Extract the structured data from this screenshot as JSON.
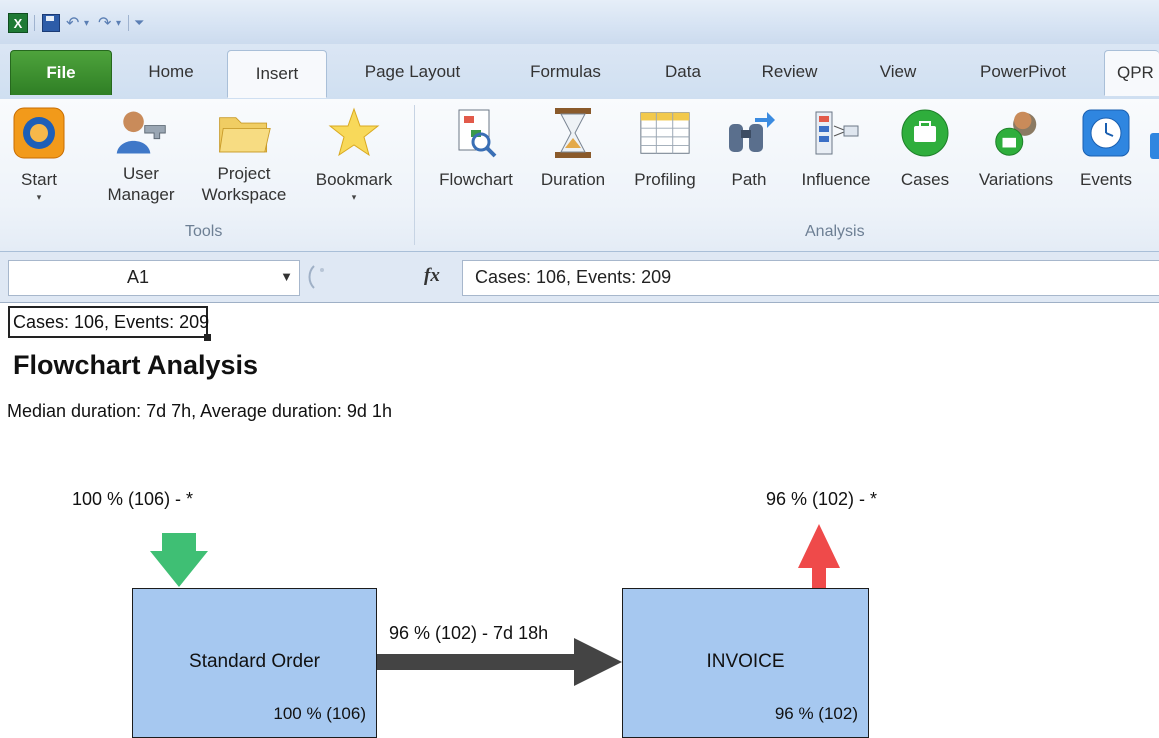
{
  "titlebar": {
    "icons": [
      "excel-logo-icon",
      "save-icon",
      "undo-icon",
      "redo-icon",
      "customize-quick-access-icon"
    ],
    "logo_letter": "X"
  },
  "tabs": [
    {
      "label": "File"
    },
    {
      "label": "Home"
    },
    {
      "label": "Insert"
    },
    {
      "label": "Page Layout"
    },
    {
      "label": "Formulas"
    },
    {
      "label": "Data"
    },
    {
      "label": "Review"
    },
    {
      "label": "View"
    },
    {
      "label": "PowerPivot"
    },
    {
      "label": "QPR"
    }
  ],
  "ribbon": {
    "groups": [
      {
        "label": "Tools"
      },
      {
        "label": "Analysis"
      }
    ],
    "tools": [
      {
        "label": "Start",
        "icon": "start-icon",
        "dropdown": "▾"
      },
      {
        "label": "User\nManager",
        "icon": "user-manager-icon"
      },
      {
        "label": "Project\nWorkspace",
        "icon": "folder-icon"
      },
      {
        "label": "Bookmark",
        "icon": "star-icon",
        "dropdown": "▾"
      }
    ],
    "analysis": [
      {
        "label": "Flowchart",
        "icon": "flowchart-icon"
      },
      {
        "label": "Duration",
        "icon": "hourglass-icon"
      },
      {
        "label": "Profiling",
        "icon": "table-icon"
      },
      {
        "label": "Path",
        "icon": "binoculars-icon"
      },
      {
        "label": "Influence",
        "icon": "influence-icon"
      },
      {
        "label": "Cases",
        "icon": "cases-icon"
      },
      {
        "label": "Variations",
        "icon": "variations-icon"
      },
      {
        "label": "Events",
        "icon": "clock-icon"
      }
    ]
  },
  "formula_bar": {
    "name_box": "A1",
    "fx_label": "fx",
    "content": "Cases: 106, Events: 209"
  },
  "sheet": {
    "cell_a1": "Cases: 106, Events: 209",
    "title": "Flowchart Analysis",
    "subtitle": "Median duration: 7d 7h, Average duration: 9d 1h"
  },
  "flowchart": {
    "start_label": "100 % (106) - *",
    "end_label": "96 % (102) - *",
    "transition_label": "96 % (102) - 7d 18h",
    "nodes": [
      {
        "name": "Standard Order",
        "pct": "100 % (106)"
      },
      {
        "name": "INVOICE",
        "pct": "96 % (102)"
      }
    ],
    "colors": {
      "node_fill": "#a6c8f0",
      "start_arrow": "#3fbf74",
      "end_arrow": "#ef4a4a",
      "transition_arrow": "#444444"
    }
  }
}
